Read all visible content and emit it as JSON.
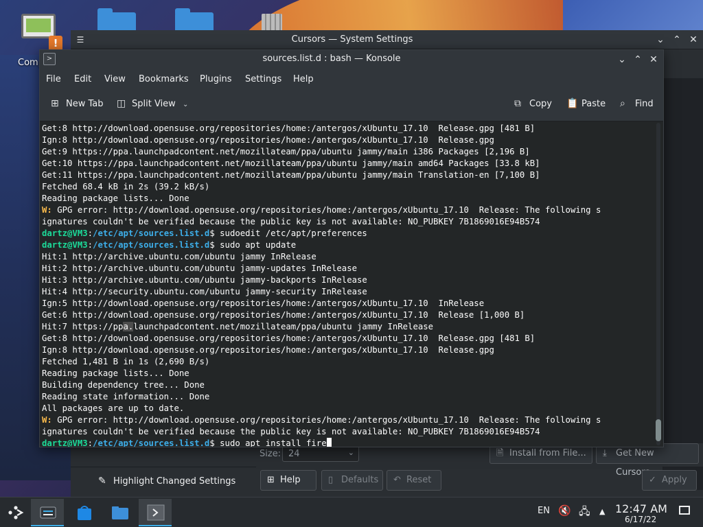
{
  "desktop": {
    "icons": [
      {
        "label": "Comp",
        "icon": "computer-icon"
      },
      {
        "label": "",
        "icon": "folder-icon"
      },
      {
        "label": "",
        "icon": "folder-icon"
      },
      {
        "label": "",
        "icon": "trash-icon"
      }
    ],
    "warning_badge": "!"
  },
  "settings_window": {
    "title": "Cursors — System Settings",
    "size_label": "Size:",
    "size_value": "24",
    "install_from_file": "Install from File...",
    "get_new_cursors": "Get New Cursors...",
    "highlight_changed": "Highlight Changed Settings",
    "help": "Help",
    "defaults": "Defaults",
    "reset": "Reset",
    "apply": "Apply"
  },
  "konsole": {
    "title": "sources.list.d : bash — Konsole",
    "menu": [
      "File",
      "Edit",
      "View",
      "Bookmarks",
      "Plugins",
      "Settings",
      "Help"
    ],
    "toolbar": {
      "new_tab": "New Tab",
      "split_view": "Split View",
      "copy": "Copy",
      "paste": "Paste",
      "find": "Find"
    },
    "prompt": {
      "user": "dartz@VM3",
      "path": "/etc/apt/sources.list.d",
      "symbol": "$"
    },
    "lines": [
      {
        "type": "out",
        "text": "Get:8 http://download.opensuse.org/repositories/home:/antergos/xUbuntu_17.10  Release.gpg [481 B]"
      },
      {
        "type": "out",
        "text": "Ign:8 http://download.opensuse.org/repositories/home:/antergos/xUbuntu_17.10  Release.gpg"
      },
      {
        "type": "out",
        "text": "Get:9 https://ppa.launchpadcontent.net/mozillateam/ppa/ubuntu jammy/main i386 Packages [2,196 B]"
      },
      {
        "type": "out",
        "text": "Get:10 https://ppa.launchpadcontent.net/mozillateam/ppa/ubuntu jammy/main amd64 Packages [33.8 kB]"
      },
      {
        "type": "out",
        "text": "Get:11 https://ppa.launchpadcontent.net/mozillateam/ppa/ubuntu jammy/main Translation-en [7,100 B]"
      },
      {
        "type": "out",
        "text": "Fetched 68.4 kB in 2s (39.2 kB/s)"
      },
      {
        "type": "out",
        "text": "Reading package lists... Done"
      },
      {
        "type": "warn",
        "prefix": "W:",
        "text": " GPG error: http://download.opensuse.org/repositories/home:/antergos/xUbuntu_17.10  Release: The following s"
      },
      {
        "type": "out",
        "text": "ignatures couldn't be verified because the public key is not available: NO_PUBKEY 7B1869016E94B574"
      },
      {
        "type": "prompt",
        "cmd": " sudoedit /etc/apt/preferences"
      },
      {
        "type": "prompt",
        "cmd": " sudo apt update"
      },
      {
        "type": "out",
        "text": "Hit:1 http://archive.ubuntu.com/ubuntu jammy InRelease"
      },
      {
        "type": "out",
        "text": "Hit:2 http://archive.ubuntu.com/ubuntu jammy-updates InRelease"
      },
      {
        "type": "out",
        "text": "Hit:3 http://archive.ubuntu.com/ubuntu jammy-backports InRelease"
      },
      {
        "type": "out",
        "text": "Hit:4 http://security.ubuntu.com/ubuntu jammy-security InRelease"
      },
      {
        "type": "out",
        "text": "Ign:5 http://download.opensuse.org/repositories/home:/antergos/xUbuntu_17.10  InRelease"
      },
      {
        "type": "out",
        "text": "Get:6 http://download.opensuse.org/repositories/home:/antergos/xUbuntu_17.10  Release [1,000 B]"
      },
      {
        "type": "hl",
        "pre": "Hit:7 https://pp",
        "hl": "a.",
        "post": "launchpadcontent.net/mozillateam/ppa/ubuntu jammy InRelease"
      },
      {
        "type": "out",
        "text": "Get:8 http://download.opensuse.org/repositories/home:/antergos/xUbuntu_17.10  Release.gpg [481 B]"
      },
      {
        "type": "out",
        "text": "Ign:8 http://download.opensuse.org/repositories/home:/antergos/xUbuntu_17.10  Release.gpg"
      },
      {
        "type": "out",
        "text": "Fetched 1,481 B in 1s (2,690 B/s)"
      },
      {
        "type": "out",
        "text": "Reading package lists... Done"
      },
      {
        "type": "out",
        "text": "Building dependency tree... Done"
      },
      {
        "type": "out",
        "text": "Reading state information... Done"
      },
      {
        "type": "out",
        "text": "All packages are up to date."
      },
      {
        "type": "warn",
        "prefix": "W:",
        "text": " GPG error: http://download.opensuse.org/repositories/home:/antergos/xUbuntu_17.10  Release: The following s"
      },
      {
        "type": "out",
        "text": "ignatures couldn't be verified because the public key is not available: NO_PUBKEY 7B1869016E94B574"
      },
      {
        "type": "prompt",
        "cmd": " sudo apt install fire",
        "cursor": true
      }
    ]
  },
  "taskbar": {
    "keyboard_layout": "EN",
    "time": "12:47 AM",
    "date": "6/17/22"
  },
  "colors": {
    "prompt_user": "#1cdc9a",
    "prompt_path": "#3daee9",
    "warning": "#fdbc4b",
    "accent": "#3daee9"
  }
}
